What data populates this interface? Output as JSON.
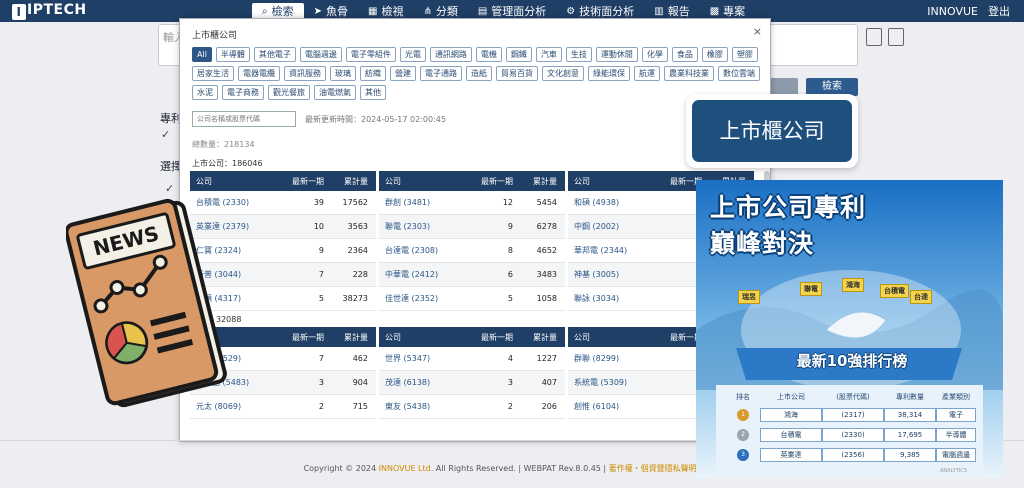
{
  "nav": {
    "logo_text": "IPTECH",
    "items": [
      {
        "icon": "search-icon",
        "label": "檢索",
        "active": true
      },
      {
        "icon": "fish-icon",
        "label": "魚骨",
        "active": false
      },
      {
        "icon": "view-icon",
        "label": "檢視",
        "active": false
      },
      {
        "icon": "branch-icon",
        "label": "分類",
        "active": false
      },
      {
        "icon": "chart-icon",
        "label": "管理面分析",
        "active": false
      },
      {
        "icon": "gear-icon",
        "label": "技術面分析",
        "active": false
      },
      {
        "icon": "report-icon",
        "label": "報告",
        "active": false
      },
      {
        "icon": "project-icon",
        "label": "專案",
        "active": false
      }
    ],
    "user": "INNOVUE",
    "logout": "登出"
  },
  "background": {
    "input_placeholder": "輸入",
    "search_button": "檢索",
    "label_1": "專利",
    "label_2": "選擇"
  },
  "modal": {
    "title": "上市櫃公司",
    "close": "×",
    "categories": [
      "All",
      "半導體",
      "其他電子",
      "電腦週邊",
      "電子零組件",
      "光電",
      "通訊網路",
      "電機",
      "鋼鐵",
      "汽車",
      "生技",
      "運動休閒",
      "化學",
      "食品",
      "橡膠",
      "塑膠",
      "居家生活",
      "電器電纜",
      "資訊服務",
      "玻璃",
      "紡織",
      "營建",
      "電子通路",
      "造紙",
      "貿易百貨",
      "文化創意",
      "綠能環保",
      "航運",
      "農業科技業",
      "數位雲端",
      "水泥",
      "電子商務",
      "觀光餐旅",
      "油電燃氣",
      "其他"
    ],
    "search_placeholder": "公司名稱或股票代碼",
    "updated": "最新更新時間：2024-05-17 02:00:45",
    "total": "總數量：218134",
    "listed_label": "上市公司：186046",
    "otc_label": "上櫃：32088",
    "col_headers": {
      "company": "公司",
      "latest": "最新一期",
      "cumulative": "累計量"
    },
    "listed_columns": [
      [
        {
          "company": "台積電 (2330)",
          "latest": "39",
          "total": "17562"
        },
        {
          "company": "英業達 (2379)",
          "latest": "10",
          "total": "3563"
        },
        {
          "company": "仁寶 (2324)",
          "latest": "9",
          "total": "2364"
        },
        {
          "company": "新普 (3044)",
          "latest": "7",
          "total": "228"
        },
        {
          "company": "和碩 (4317)",
          "latest": "5",
          "total": "38273"
        }
      ],
      [
        {
          "company": "群創 (3481)",
          "latest": "12",
          "total": "5454"
        },
        {
          "company": "聯電 (2303)",
          "latest": "9",
          "total": "6278"
        },
        {
          "company": "台達電 (2308)",
          "latest": "8",
          "total": "4652"
        },
        {
          "company": "中華電 (2412)",
          "latest": "6",
          "total": "3483"
        },
        {
          "company": "佳世達 (2352)",
          "latest": "5",
          "total": "1058"
        }
      ],
      [
        {
          "company": "和碩 (4938)",
          "latest": "",
          "total": ""
        },
        {
          "company": "中鋼 (2002)",
          "latest": "",
          "total": ""
        },
        {
          "company": "華邦電 (2344)",
          "latest": "",
          "total": ""
        },
        {
          "company": "神基 (3005)",
          "latest": "",
          "total": ""
        },
        {
          "company": "聯詠 (3034)",
          "latest": "",
          "total": ""
        }
      ]
    ],
    "otc_columns": [
      [
        {
          "company": "力旺 (3529)",
          "latest": "7",
          "total": "462"
        },
        {
          "company": "中美晶 (5483)",
          "latest": "3",
          "total": "904"
        },
        {
          "company": "元太 (8069)",
          "latest": "2",
          "total": "715"
        }
      ],
      [
        {
          "company": "世界 (5347)",
          "latest": "4",
          "total": "1227"
        },
        {
          "company": "茂達 (6138)",
          "latest": "3",
          "total": "407"
        },
        {
          "company": "東友 (5438)",
          "latest": "2",
          "total": "206"
        }
      ],
      [
        {
          "company": "群聯 (8299)",
          "latest": "",
          "total": ""
        },
        {
          "company": "系統電 (5309)",
          "latest": "",
          "total": ""
        },
        {
          "company": "創惟 (6104)",
          "latest": "",
          "total": ""
        }
      ]
    ]
  },
  "footer": {
    "prefix": "Copyright © 2024 ",
    "company": "INNOVUE Ltd.",
    "middle": " All Rights Reserved. | WEBPAT Rev.8.0.45 | ",
    "link": "著作權・個資暨隱私聲明 | 聯絡"
  },
  "overlays": {
    "news_label": "NEWS",
    "callout": "上市櫃公司",
    "poster": {
      "title_1": "上市公司專利",
      "title_2": "巔峰對決",
      "flags": [
        "瑞昱",
        "聯電",
        "鴻海",
        "台積電",
        "台達"
      ],
      "subtitle": "最新10強排行榜",
      "headers": [
        "排名",
        "上市公司",
        "(股票代碼)",
        "專利數量",
        "產業類別"
      ],
      "rows": [
        {
          "rank": "1",
          "company": "鴻海",
          "code": "(2317)",
          "count": "38,314",
          "industry": "電子"
        },
        {
          "rank": "2",
          "company": "台積電",
          "code": "(2330)",
          "count": "17,695",
          "industry": "半導體"
        },
        {
          "rank": "3",
          "company": "英業達",
          "code": "(2356)",
          "count": "9,385",
          "industry": "電腦週邊"
        }
      ],
      "watermark": "ANALYTICS"
    }
  }
}
